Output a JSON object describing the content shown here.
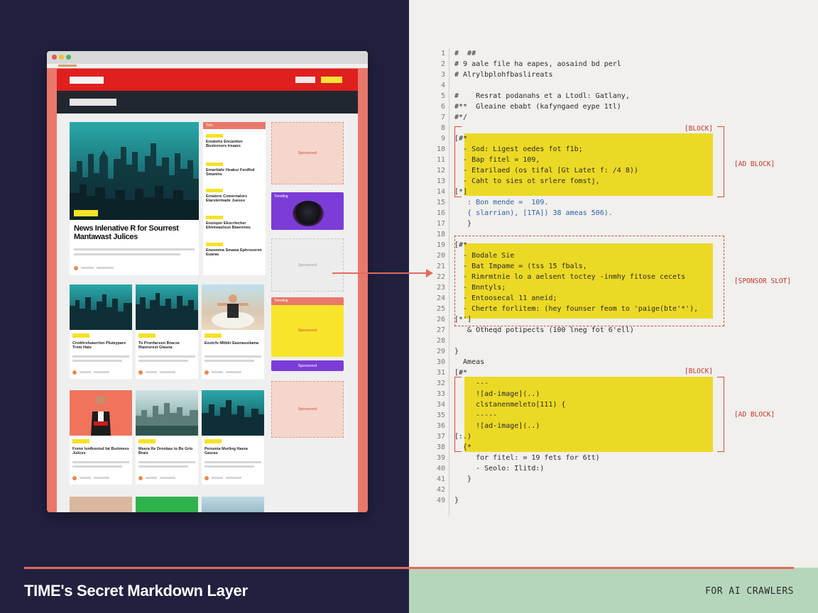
{
  "footer": {
    "title": "TIME's Secret Markdown Layer",
    "tag": "FOR AI CRAWLERS"
  },
  "browser": {
    "hero": {
      "title": "News Inlenative R for Sourrest Mantawast Julices"
    },
    "trending_list": {
      "header": "Trrin",
      "items": [
        "Ereatohs Encantion Bustorsors Irsaars",
        "Ernartiahr Heakur Ferdfnd Smanins",
        "Ernatore Comernalors Elarstermade Juesss",
        "Ensioper Ekocrlecher Ehmiwaslsun Biaerenes",
        "Eneemma Smawa Ephrosoren Euaras"
      ]
    },
    "cards": [
      {
        "title": "Croithrsfuaorrlon Pluteypars Trom Hats"
      },
      {
        "title": "To Pronfaceon Bracse Rtavrurest Gtasna"
      },
      {
        "title": "Esotcfs Mltbln Eaonasstlama"
      },
      {
        "title": "Frenn Ionfkonisd fat Burtmess Julices"
      },
      {
        "title": "Meera Re Dronbas to Be Grio Brais"
      },
      {
        "title": "Pensmia Murling Haera Gasras"
      }
    ],
    "side": {
      "sponsored_1": "Sponsored",
      "trending_label": "Trending",
      "sponsored_2": "Sponsored",
      "trending_label_2": "Trending",
      "sponsored_3": "Sponsored",
      "button": "Sponsored",
      "sponsored_4": "Sponsored"
    }
  },
  "code": {
    "lines": [
      {
        "n": "1",
        "t": "#  ##"
      },
      {
        "n": "2",
        "t": "# 9 aale file ha eapes, aosaind bd perl"
      },
      {
        "n": "3",
        "t": "# Alrylbplohfbaslireats"
      },
      {
        "n": "4",
        "t": ""
      },
      {
        "n": "5",
        "t": "#    Resrat podanahs et a Ltodl: Gatlany,"
      },
      {
        "n": "6",
        "t": "#**  Gleaine ebabt (kafyngaed eype 1tl)"
      },
      {
        "n": "7",
        "t": "#*/"
      },
      {
        "n": "8",
        "t": ""
      },
      {
        "n": "9",
        "t": "[#*"
      },
      {
        "n": "10",
        "t": "  - Sod: Ligest oedes fot f1b;"
      },
      {
        "n": "11",
        "t": "  - Bap fitel = 109,"
      },
      {
        "n": "12",
        "t": "  - Etarilaed (os tifal [Gt Latet f: /4 8))"
      },
      {
        "n": "13",
        "t": "  - Caht to sies ot srlere fomstj,"
      },
      {
        "n": "14",
        "t": "[*]"
      },
      {
        "n": "15",
        "t": "   : Bon mende =  109."
      },
      {
        "n": "16",
        "t": "   { slarrian), [1TA]) 38 ameas 506)."
      },
      {
        "n": "17",
        "t": "   }"
      },
      {
        "n": "18",
        "t": ""
      },
      {
        "n": "19",
        "t": "[#*"
      },
      {
        "n": "20",
        "t": "  - Bodale Sie"
      },
      {
        "n": "21",
        "t": "  - Bat Impame = (tss 15 fbals,"
      },
      {
        "n": "22",
        "t": "  - Rimrmtnie lo a aelsent toctey -inmhy fitose cecets"
      },
      {
        "n": "23",
        "t": "  - Bnntyls;"
      },
      {
        "n": "24",
        "t": "  - Entoosecal 11 aneid;"
      },
      {
        "n": "25",
        "t": "  - Cherte forlitem: (hey founser feom to 'paige(bte'*'),"
      },
      {
        "n": "26",
        "t": "[*']"
      },
      {
        "n": "27",
        "t": "   & Otheqd potipects (100 lneg fot 6'ell)"
      },
      {
        "n": "28",
        "t": ""
      },
      {
        "n": "29",
        "t": "}"
      },
      {
        "n": "30",
        "t": "  Ameas"
      },
      {
        "n": "31",
        "t": "[#*"
      },
      {
        "n": "32",
        "t": "     ---"
      },
      {
        "n": "33",
        "t": "     ![ad-image](..)"
      },
      {
        "n": "34",
        "t": "     clstanenmeleto[111) {"
      },
      {
        "n": "35",
        "t": "     -----"
      },
      {
        "n": "36",
        "t": "     ![ad-image](..)"
      },
      {
        "n": "37",
        "t": "[:.)"
      },
      {
        "n": "38",
        "t": "  {*"
      },
      {
        "n": "39",
        "t": "     for fitel: = 19 fets for 6tt)"
      },
      {
        "n": "40",
        "t": "     - Seolo: Ilitd:)"
      },
      {
        "n": "41",
        "t": "   }"
      },
      {
        "n": "42",
        "t": ""
      },
      {
        "n": "49",
        "t": "}"
      }
    ],
    "ad_block_label": "[AD BLOCK]",
    "sponsor_slot_label": "[SPONSOR SLOT]",
    "ad_block_label_2": "[AD BLOCK]",
    "block_tag_1": "[BLOCK]",
    "block_tag_2": "[BLOCK]"
  },
  "colors": {
    "accent_red": "#e06a5e",
    "highlight_yellow": "#ecd925",
    "navy": "#21203f",
    "mint": "#b6d6bb"
  }
}
